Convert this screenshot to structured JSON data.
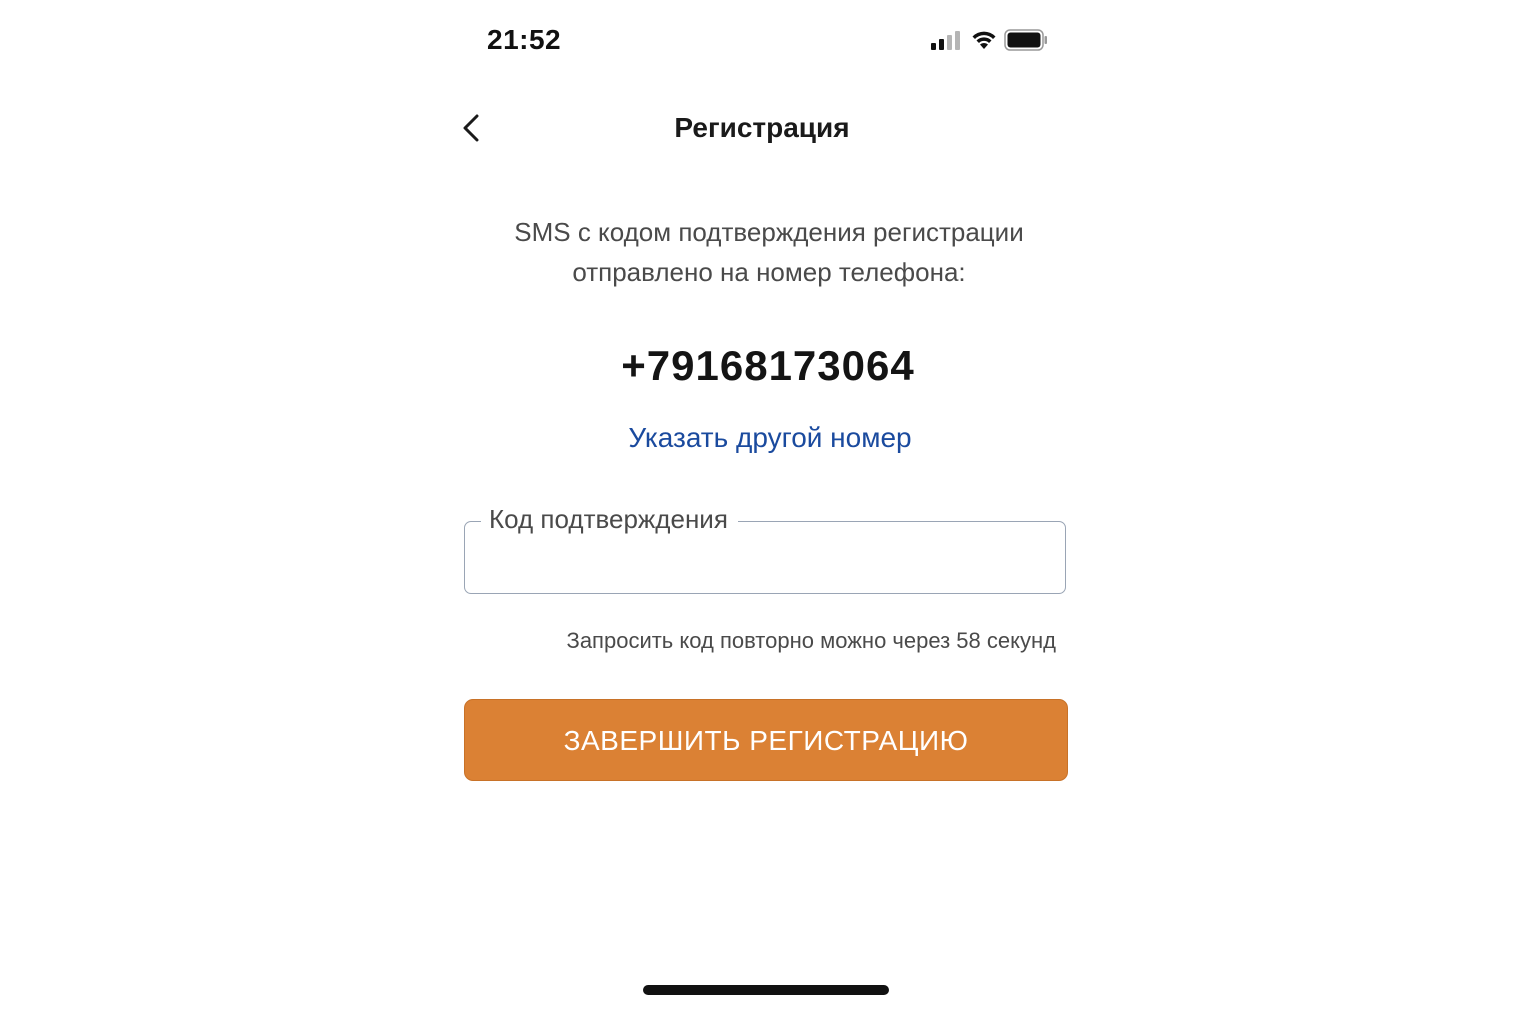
{
  "status_bar": {
    "time": "21:52",
    "icons": [
      "signal-icon",
      "wifi-icon",
      "battery-icon"
    ]
  },
  "header": {
    "back_icon": "chevron-left-icon",
    "title": "Регистрация"
  },
  "info": {
    "line1": "SMS с кодом подтверждения регистрации",
    "line2": "отправлено на номер телефона:"
  },
  "phone": {
    "number": "+79168173064",
    "change_link": "Указать другой номер"
  },
  "code_input": {
    "label": "Код подтверждения",
    "value": ""
  },
  "resend": {
    "text": "Запросить код повторно можно через 58 секунд"
  },
  "submit": {
    "label": "ЗАВЕРШИТЬ РЕГИСТРАЦИЮ"
  },
  "colors": {
    "accent": "#db8134",
    "link": "#1a4a9e",
    "text": "#4a4a4a"
  }
}
